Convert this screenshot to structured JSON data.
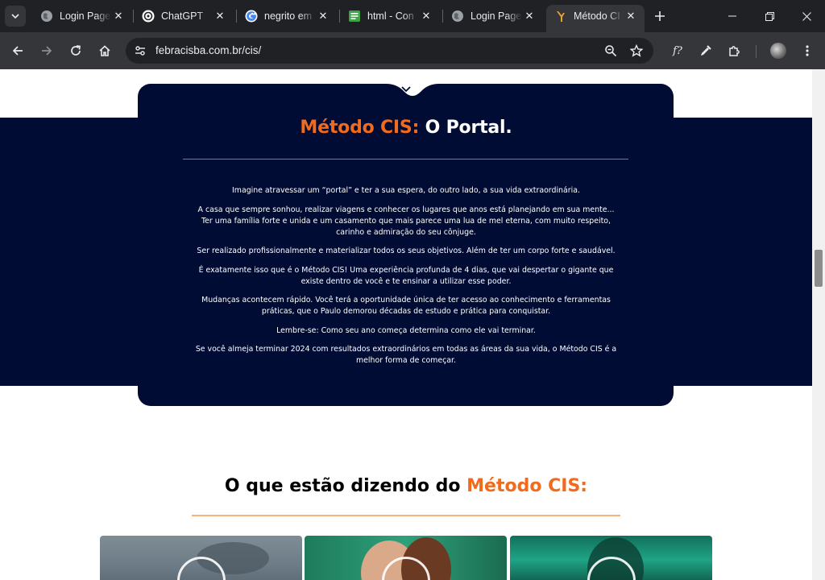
{
  "browser": {
    "tabs": [
      {
        "title": "Login Page",
        "icon": "globe-icon",
        "active": false
      },
      {
        "title": "ChatGPT",
        "icon": "chatgpt-icon",
        "active": false
      },
      {
        "title": "negrito em",
        "icon": "google-icon",
        "active": false
      },
      {
        "title": "html - Con",
        "icon": "stackexchange-icon",
        "active": false
      },
      {
        "title": "Login Page",
        "icon": "globe-icon",
        "active": false
      },
      {
        "title": "Método CI",
        "icon": "site-icon",
        "active": true
      }
    ],
    "url": "febracisba.com.br/cis/"
  },
  "card": {
    "title_accent": "Método CIS:",
    "title_rest": "O Portal.",
    "paragraphs": [
      "Imagine atravessar um “portal” e ter a sua espera, do outro lado, a sua vida extraordinária.",
      "A casa que sempre sonhou, realizar viagens e conhecer os lugares que anos está planejando em sua mente... Ter uma família forte e unida e um casamento que mais parece uma lua de mel eterna, com muito respeito, carinho e admiração do seu cônjuge.",
      "Ser realizado profissionalmente e materializar todos os seus objetivos. Além de ter um corpo forte e saudável.",
      "É exatamente isso que é o Método CIS! Uma experiência profunda de 4 dias, que vai despertar o gigante que existe dentro de você e te ensinar a utilizar esse poder.",
      "Mudanças acontecem rápido. Você terá a oportunidade única de ter acesso ao conhecimento e ferramentas práticas, que o Paulo demorou décadas de estudo e prática para conquistar.",
      "Lembre-se: Como seu ano começa determina como ele vai terminar.",
      "Se você almeja terminar 2024 com resultados extraordinários em todas as áreas da sua vida, o Método CIS é a melhor forma de começar."
    ]
  },
  "testimonials": {
    "title_prefix": "O que estão dizendo do",
    "title_accent": "Método CIS:"
  },
  "colors": {
    "accent": "#f26a1b",
    "navy": "#000c34"
  }
}
